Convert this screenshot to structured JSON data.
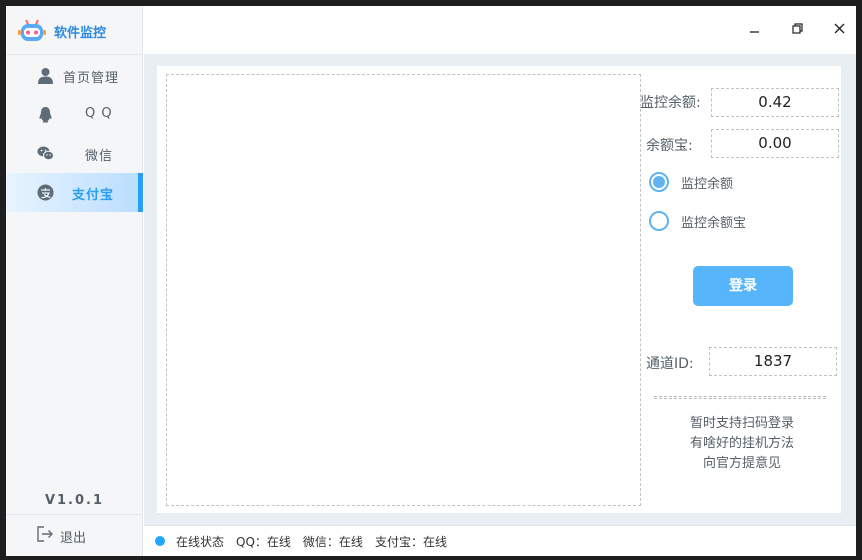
{
  "app": {
    "title": "软件监控",
    "version": "V1.0.1"
  },
  "sidebar": {
    "items": [
      {
        "label": "首页管理",
        "icon": "user-icon",
        "active": false
      },
      {
        "label": "Q Q",
        "icon": "qq-icon",
        "active": false
      },
      {
        "label": "微信",
        "icon": "wechat-icon",
        "active": false
      },
      {
        "label": "支付宝",
        "icon": "alipay-icon",
        "active": true
      }
    ],
    "logout_label": "退出"
  },
  "window_controls": [
    "minimize-icon",
    "restore-icon",
    "close-icon"
  ],
  "form": {
    "balance_label": "监控余额:",
    "balance_value": "0.42",
    "yuebao_label": "余额宝:",
    "yuebao_value": "0.00",
    "radio_options": [
      {
        "label": "监控余额",
        "checked": true
      },
      {
        "label": "监控余额宝",
        "checked": false
      }
    ],
    "login_label": "登录",
    "channel_label": "通道ID:",
    "channel_value": "1837",
    "tips": [
      "暂时支持扫码登录",
      "有啥好的挂机方法",
      "向官方提意见"
    ]
  },
  "status": {
    "label": "在线状态",
    "qq": "QQ：在线",
    "wechat": "微信：在线",
    "alipay": "支付宝：在线"
  },
  "colors": {
    "accent": "#2a9df4",
    "button": "#56b5fb",
    "status_dot": "#1ea7fd",
    "sidebar_bg": "#f4f6f8",
    "content_bg": "#e9eef3"
  }
}
